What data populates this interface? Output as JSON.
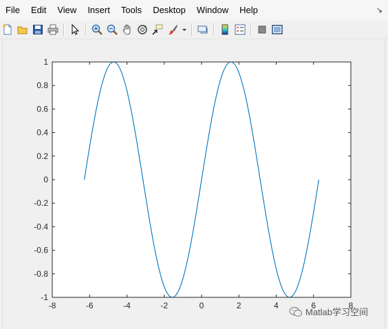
{
  "menu": {
    "items": [
      "File",
      "Edit",
      "View",
      "Insert",
      "Tools",
      "Desktop",
      "Window",
      "Help"
    ]
  },
  "toolbar": {
    "icons": [
      "new-figure-icon",
      "open-file-icon",
      "save-icon",
      "print-icon",
      "pointer-icon",
      "zoom-in-icon",
      "zoom-out-icon",
      "pan-icon",
      "rotate-3d-icon",
      "data-cursor-icon",
      "brush-icon",
      "dropdown-arrow-icon",
      "link-plot-icon",
      "colorbar-icon",
      "legend-icon",
      "hide-plot-tools-icon",
      "show-plot-tools-icon"
    ]
  },
  "watermark": {
    "text": "Matlab学习空间"
  },
  "chart_data": {
    "type": "line",
    "title": "",
    "xlabel": "",
    "ylabel": "",
    "xlim": [
      -8,
      8
    ],
    "ylim": [
      -1,
      1
    ],
    "xticks": [
      -8,
      -6,
      -4,
      -2,
      0,
      2,
      4,
      6,
      8
    ],
    "yticks": [
      -1,
      -0.8,
      -0.6,
      -0.4,
      -0.2,
      0,
      0.2,
      0.4,
      0.6,
      0.8,
      1
    ],
    "xtick_labels": [
      "-8",
      "-6",
      "-4",
      "-2",
      "0",
      "2",
      "4",
      "6",
      "8"
    ],
    "ytick_labels": [
      "-1",
      "-0.8",
      "-0.6",
      "-0.4",
      "-0.2",
      "0",
      "0.2",
      "0.4",
      "0.6",
      "0.8",
      "1"
    ],
    "grid": false,
    "series": [
      {
        "color": "#0072bd",
        "x": [
          -6.2832,
          -5.969,
          -5.6549,
          -5.3407,
          -5.0265,
          -4.7124,
          -4.3982,
          -4.0841,
          -3.7699,
          -3.4558,
          -3.1416,
          -2.8274,
          -2.5133,
          -2.1991,
          -1.885,
          -1.5708,
          -1.2566,
          -0.9425,
          -0.6283,
          -0.3142,
          0,
          0.3142,
          0.6283,
          0.9425,
          1.2566,
          1.5708,
          1.885,
          2.1991,
          2.5133,
          2.8274,
          3.1416,
          3.4558,
          3.7699,
          4.0841,
          4.3982,
          4.7124,
          5.0265,
          5.3407,
          5.6549,
          5.969,
          6.2832
        ],
        "y": [
          0,
          0.309,
          0.5878,
          0.809,
          0.9511,
          1,
          0.9511,
          0.809,
          0.5878,
          0.309,
          0,
          -0.309,
          -0.5878,
          -0.809,
          -0.9511,
          -1,
          -0.9511,
          -0.809,
          -0.5878,
          -0.309,
          0,
          0.309,
          0.5878,
          0.809,
          0.9511,
          1,
          0.9511,
          0.809,
          0.5878,
          0.309,
          0,
          -0.309,
          -0.5878,
          -0.809,
          -0.9511,
          -1,
          -0.9511,
          -0.809,
          -0.5878,
          -0.309,
          0
        ]
      }
    ]
  }
}
